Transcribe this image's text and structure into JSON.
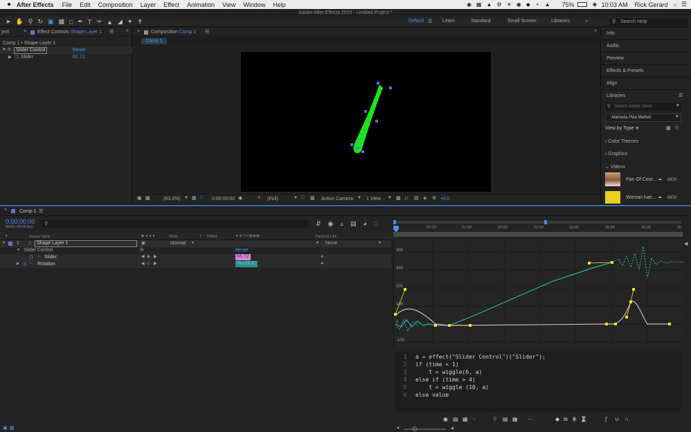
{
  "menubar": {
    "app": "After Effects",
    "menus": [
      "File",
      "Edit",
      "Composition",
      "Layer",
      "Effect",
      "Animation",
      "View",
      "Window",
      "Help"
    ],
    "battery": "75%",
    "time": "10:03 AM",
    "user": "Rick Gerard"
  },
  "window_title": "Adobe After Effects 2020 - Untitled Project *",
  "workspaces": {
    "items": [
      "Default",
      "Learn",
      "Standard",
      "Small Screen",
      "Libraries"
    ],
    "search_placeholder": "Search Help"
  },
  "left_panel": {
    "tab_prev": "ject",
    "tab_label": "Effect Controls",
    "tab_target": "Shape Layer 1",
    "breadcrumb": "Comp 1 • Shape Layer 1",
    "effect_name": "Slider Control",
    "reset_label": "Reset",
    "param_name": "Slider",
    "param_value": "66.72"
  },
  "comp_panel": {
    "tab_label": "Composition",
    "tab_target": "Comp 1",
    "subtab": "Comp 1",
    "zoom": "(63.3%)",
    "timecode": "0:00:00:00",
    "resolution": "(Full)",
    "camera": "Active Camera",
    "view": "1 View",
    "exposure": "+0.0"
  },
  "right_panel": {
    "items": [
      "Info",
      "Audio",
      "Preview",
      "Effects & Presets",
      "Align",
      "Libraries"
    ],
    "stock_search_placeholder": "Search Adobe Stock",
    "library_name": "Alameda Flea Market",
    "view_by": "View by Type",
    "sections": [
      "Color Themes",
      "Graphics",
      "Videos"
    ],
    "videos": [
      {
        "name": "Pan Of Cour...",
        "format": "MOV"
      },
      {
        "name": "Woman han...",
        "format": "MOV"
      }
    ]
  },
  "timeline": {
    "tab_label": "Comp 1",
    "timecode": "0:00:00:00",
    "fps": "00000 (30.00 fps)",
    "search_placeholder": "",
    "col_source": "Source Name",
    "col_mode": "Mode",
    "col_t": "T",
    "col_trkmat": "TrkMat",
    "col_parent": "Parent & Link",
    "layer_num": "1",
    "layer_name": "Shape Layer 1",
    "layer_mode": "Normal",
    "layer_parent": "None",
    "fx_label": "fx",
    "effect_name": "Slider Control",
    "reset_label": "Reset",
    "slider_label": "Slider",
    "slider_value": "66.72",
    "rotation_label": "Rotation",
    "rotation_value": "0x+28.8°",
    "ruler_labels": [
      "0f",
      "00:10f",
      "01:05f",
      "02:00f",
      "02:10f",
      "03:05f",
      "04:00f",
      "04:10f",
      "05"
    ],
    "graph_y_labels": [
      "400",
      "300",
      "200",
      "100",
      "0",
      "-100"
    ]
  },
  "expression": {
    "lines": [
      {
        "n": "1",
        "code": "a = effect(\"Slider Control\")(\"Slider\");"
      },
      {
        "n": "2",
        "code": "if (time < 1)"
      },
      {
        "n": "3",
        "code": "    t = wiggle(6, a)"
      },
      {
        "n": "4",
        "code": "else if (time > 4)"
      },
      {
        "n": "5",
        "code": "    t = wiggle (10, a)"
      },
      {
        "n": "6",
        "code": "else value"
      }
    ]
  },
  "colors": {
    "accent": "#4b8fe6",
    "shape_fill": "#19e619",
    "rotation_curve": "#2ab5a5",
    "speed_curve": "#d9a8d9",
    "keyframe": "#e6e62e",
    "slider_value_bg": "#d98cd9",
    "rotation_value_bg": "#2e8c8c"
  },
  "icons": [
    "apple-icon",
    "selection-tool-icon",
    "hand-tool-icon",
    "zoom-tool-icon",
    "camera-tool-icon",
    "pen-tool-icon",
    "text-tool-icon",
    "brush-tool-icon",
    "stopwatch-icon",
    "search-icon",
    "eye-icon",
    "lock-icon",
    "keyframe-icon",
    "graph-editor-icon"
  ]
}
